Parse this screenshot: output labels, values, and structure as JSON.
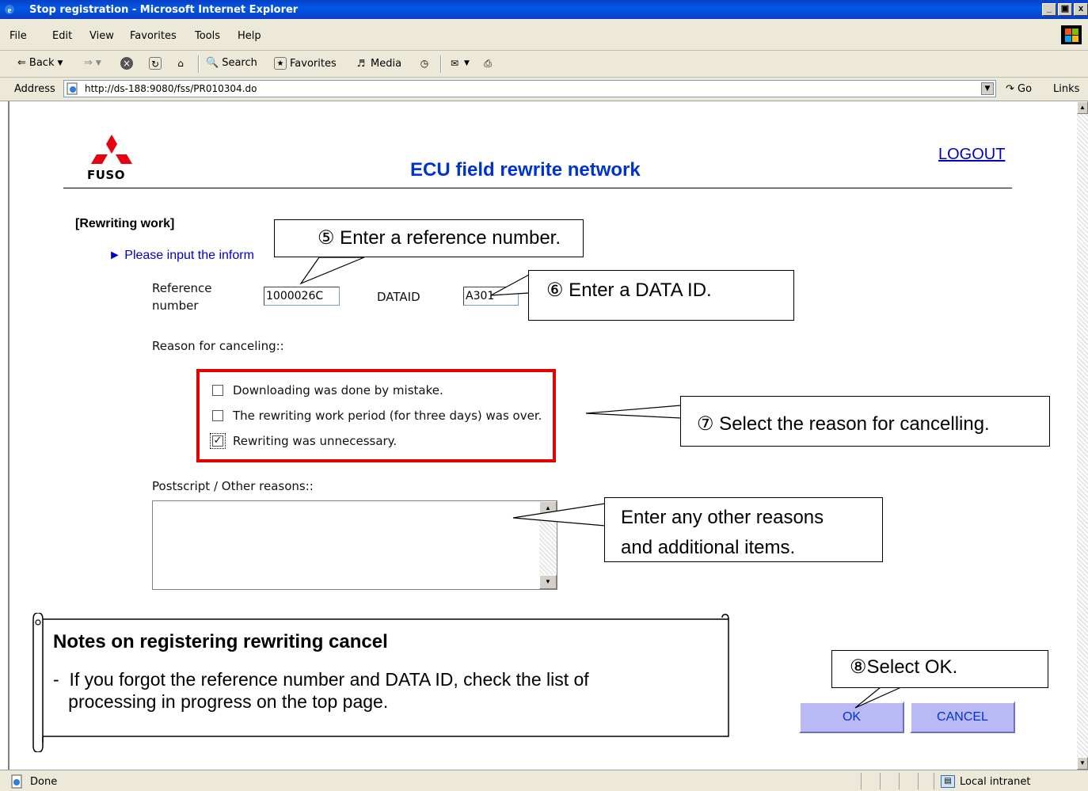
{
  "window": {
    "title": "Stop registration - Microsoft Internet Explorer",
    "buttons": [
      "_",
      " ",
      "x"
    ]
  },
  "menu": [
    "File",
    "Edit",
    "View",
    "Favorites",
    "Tools",
    "Help"
  ],
  "toolbar": {
    "back": "Back",
    "search": "Search",
    "favorites": "Favorites",
    "media": "Media"
  },
  "address": {
    "label": "Address",
    "url": "http://ds-188:9080/fss/PR010304.do",
    "go": "Go",
    "links": "Links"
  },
  "status": {
    "text": "Done",
    "zone": "Local intranet"
  },
  "page": {
    "logo_text": "FUSO",
    "title": "ECU field rewrite network",
    "logout": "LOGOUT",
    "section": "[Rewriting work]",
    "instruction_visible": "► Please input the inform",
    "reference_label_1": "Reference",
    "reference_label_2": "number",
    "reference_value": "1000026C",
    "dataid_label": "DATAID",
    "dataid_value": "A301",
    "reason_label": "Reason for canceling::",
    "reasons": [
      {
        "label": "Downloading was done by mistake.",
        "checked": false
      },
      {
        "label": "The rewriting work period (for three days) was over.",
        "checked": false
      },
      {
        "label": "Rewriting was unnecessary.",
        "checked": true
      }
    ],
    "postscript_label": "Postscript / Other reasons::",
    "ok": "OK",
    "cancel": "CANCEL"
  },
  "callouts": {
    "c5": "⑤ Enter a reference number.",
    "c6": "⑥ Enter a DATA ID.",
    "c7": "⑦ Select the reason for cancelling.",
    "other_1": "Enter any other reasons",
    "other_2": "and additional items.",
    "c8": "⑧Select OK."
  },
  "notes": {
    "title": "Notes on registering rewriting cancel",
    "line1": "-  If you forgot the reference number and DATA ID, check the list of",
    "line2": "   processing in progress on the top page."
  },
  "colors": {
    "accent": "#0033cc",
    "highlight": "#e60000",
    "button": "#b9b9f6"
  }
}
